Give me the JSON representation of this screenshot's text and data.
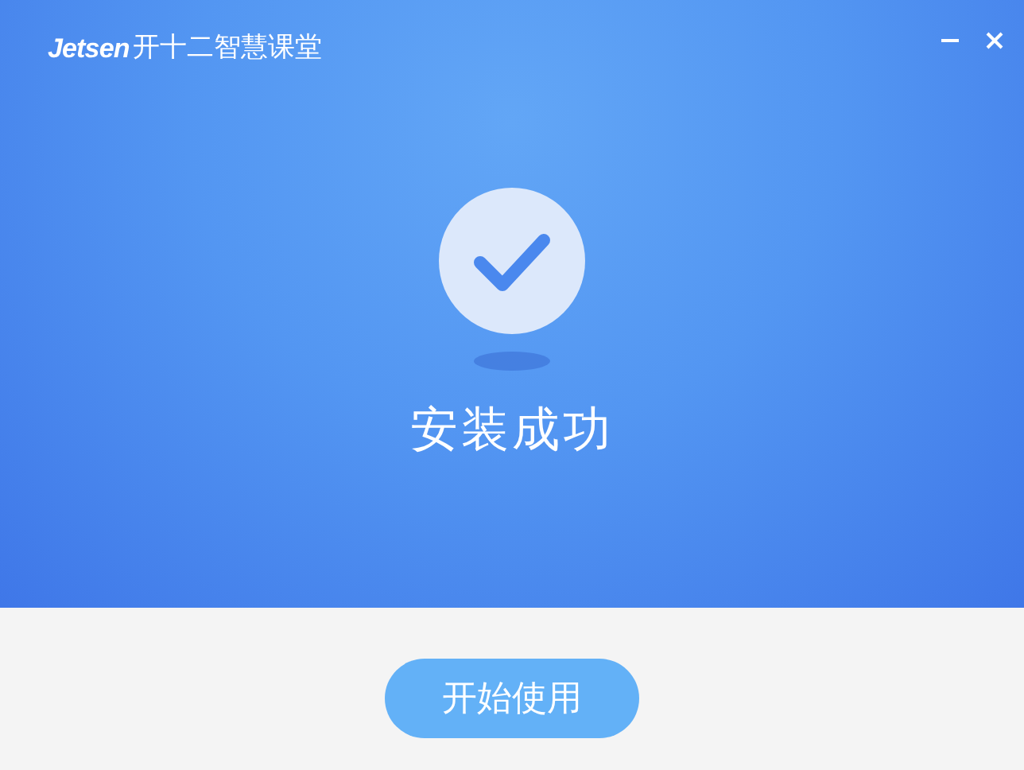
{
  "window": {
    "brand": "Jetsen",
    "title": "开十二智慧课堂"
  },
  "status": {
    "message": "安装成功"
  },
  "footer": {
    "button": "开始使用"
  }
}
